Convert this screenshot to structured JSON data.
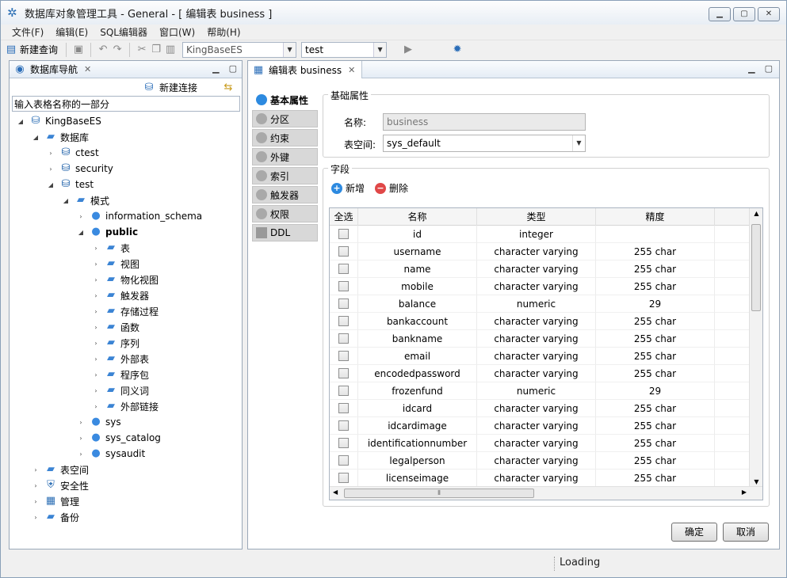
{
  "window": {
    "title": "数据库对象管理工具 - General - [ 编辑表 business ]",
    "controls": [
      "▁",
      "▢",
      "✕"
    ]
  },
  "menu": [
    "文件(F)",
    "编辑(E)",
    "SQL编辑器",
    "窗口(W)",
    "帮助(H)"
  ],
  "toolbar": {
    "new_query_label": "新建查询",
    "db_combo_value": "KingBaseES",
    "schema_combo_value": "test"
  },
  "nav": {
    "tab_title": "数据库导航",
    "new_connection_label": "新建连接",
    "filter_value": "输入表格名称的一部分",
    "tree": [
      {
        "label": "KingBaseES",
        "icon": "server-icon",
        "twisty": "◢",
        "bold": false
      },
      {
        "label": "数据库",
        "icon": "folder-icon",
        "twisty": "◢",
        "bold": false
      },
      {
        "label": "ctest",
        "icon": "database-icon",
        "twisty": "›",
        "bold": false
      },
      {
        "label": "security",
        "icon": "database-icon",
        "twisty": "›",
        "bold": false
      },
      {
        "label": "test",
        "icon": "database-icon",
        "twisty": "◢",
        "bold": false
      },
      {
        "label": "模式",
        "icon": "folder-icon",
        "twisty": "◢",
        "bold": false
      },
      {
        "label": "information_schema",
        "icon": "user-icon",
        "twisty": "›",
        "bold": false
      },
      {
        "label": "public",
        "icon": "user-icon",
        "twisty": "◢",
        "bold": true
      },
      {
        "label": "表",
        "icon": "folder-icon",
        "twisty": "›",
        "bold": false
      },
      {
        "label": "视图",
        "icon": "folder-icon",
        "twisty": "›",
        "bold": false
      },
      {
        "label": "物化视图",
        "icon": "folder-icon",
        "twisty": "›",
        "bold": false
      },
      {
        "label": "触发器",
        "icon": "folder-icon",
        "twisty": "›",
        "bold": false
      },
      {
        "label": "存储过程",
        "icon": "folder-icon",
        "twisty": "›",
        "bold": false
      },
      {
        "label": "函数",
        "icon": "folder-icon",
        "twisty": "›",
        "bold": false
      },
      {
        "label": "序列",
        "icon": "folder-icon",
        "twisty": "›",
        "bold": false
      },
      {
        "label": "外部表",
        "icon": "folder-icon",
        "twisty": "›",
        "bold": false
      },
      {
        "label": "程序包",
        "icon": "folder-icon",
        "twisty": "›",
        "bold": false
      },
      {
        "label": "同义词",
        "icon": "folder-icon",
        "twisty": "›",
        "bold": false
      },
      {
        "label": "外部链接",
        "icon": "folder-icon",
        "twisty": "›",
        "bold": false
      },
      {
        "label": "sys",
        "icon": "user-icon",
        "twisty": "›",
        "bold": false
      },
      {
        "label": "sys_catalog",
        "icon": "user-icon",
        "twisty": "›",
        "bold": false
      },
      {
        "label": "sysaudit",
        "icon": "user-icon",
        "twisty": "›",
        "bold": false
      },
      {
        "label": "表空间",
        "icon": "folder-icon",
        "twisty": "›",
        "bold": false
      },
      {
        "label": "安全性",
        "icon": "shield-icon",
        "twisty": "›",
        "bold": false
      },
      {
        "label": "管理",
        "icon": "manage-icon",
        "twisty": "›",
        "bold": false
      },
      {
        "label": "备份",
        "icon": "folder-icon",
        "twisty": "›",
        "bold": false
      }
    ]
  },
  "editor": {
    "tab_title": "编辑表 business",
    "side_tabs": [
      "基本属性",
      "分区",
      "约束",
      "外键",
      "索引",
      "触发器",
      "权限",
      "DDL"
    ],
    "basic": {
      "group_title": "基础属性",
      "name_label": "名称:",
      "name_value": "business",
      "tablespace_label": "表空间:",
      "tablespace_value": "sys_default"
    },
    "fields": {
      "group_title": "字段",
      "add_label": "新增",
      "delete_label": "删除",
      "columns": [
        "全选",
        "名称",
        "类型",
        "精度"
      ],
      "rows": [
        {
          "name": "id",
          "type": "integer",
          "precision": ""
        },
        {
          "name": "username",
          "type": "character varying",
          "precision": "255 char"
        },
        {
          "name": "name",
          "type": "character varying",
          "precision": "255 char"
        },
        {
          "name": "mobile",
          "type": "character varying",
          "precision": "255 char"
        },
        {
          "name": "balance",
          "type": "numeric",
          "precision": "29"
        },
        {
          "name": "bankaccount",
          "type": "character varying",
          "precision": "255 char"
        },
        {
          "name": "bankname",
          "type": "character varying",
          "precision": "255 char"
        },
        {
          "name": "email",
          "type": "character varying",
          "precision": "255 char"
        },
        {
          "name": "encodedpassword",
          "type": "character varying",
          "precision": "255 char"
        },
        {
          "name": "frozenfund",
          "type": "numeric",
          "precision": "29"
        },
        {
          "name": "idcard",
          "type": "character varying",
          "precision": "255 char"
        },
        {
          "name": "idcardimage",
          "type": "character varying",
          "precision": "255 char"
        },
        {
          "name": "identificationnumber",
          "type": "character varying",
          "precision": "255 char"
        },
        {
          "name": "legalperson",
          "type": "character varying",
          "precision": "255 char"
        },
        {
          "name": "licenseimage",
          "type": "character varying",
          "precision": "255 char"
        }
      ]
    },
    "ok_label": "确定",
    "cancel_label": "取消"
  },
  "status": {
    "text": "Loading"
  },
  "colors": {
    "accent": "#2d6fb5",
    "add": "#2d8ae0",
    "delete": "#e04848"
  }
}
